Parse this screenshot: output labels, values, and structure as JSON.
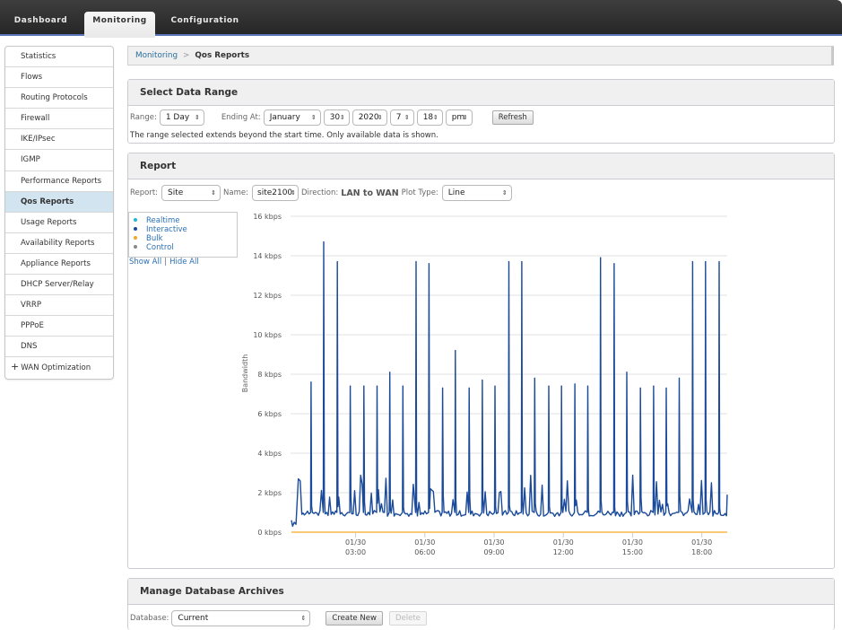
{
  "nav": {
    "tabs": [
      {
        "label": "Dashboard",
        "active": false
      },
      {
        "label": "Monitoring",
        "active": true
      },
      {
        "label": "Configuration",
        "active": false
      }
    ]
  },
  "sidebar": {
    "items": [
      {
        "label": "Statistics"
      },
      {
        "label": "Flows"
      },
      {
        "label": "Routing Protocols"
      },
      {
        "label": "Firewall"
      },
      {
        "label": "IKE/IPsec"
      },
      {
        "label": "IGMP"
      },
      {
        "label": "Performance Reports"
      },
      {
        "label": "Qos Reports",
        "active": true
      },
      {
        "label": "Usage Reports"
      },
      {
        "label": "Availability Reports"
      },
      {
        "label": "Appliance Reports"
      },
      {
        "label": "DHCP Server/Relay"
      },
      {
        "label": "VRRP"
      },
      {
        "label": "PPPoE"
      },
      {
        "label": "DNS"
      },
      {
        "label": "WAN Optimization",
        "expandable": true,
        "expand_symbol": "+"
      }
    ]
  },
  "breadcrumb": {
    "parent": "Monitoring",
    "separator": ">",
    "current": "Qos Reports"
  },
  "data_range": {
    "title": "Select Data Range",
    "range_label": "Range:",
    "range_value": "1 Day",
    "ending_label": "Ending At:",
    "month": "January",
    "day": "30",
    "year": "2020",
    "hour": "7",
    "minute": "18",
    "ampm": "pm",
    "refresh_label": "Refresh",
    "note": "The range selected extends beyond the start time. Only available data is shown."
  },
  "report": {
    "title": "Report",
    "report_label": "Report:",
    "report_value": "Site",
    "name_label": "Name:",
    "name_value": "site2100",
    "direction_label": "Direction:",
    "direction_value": "LAN to WAN",
    "plot_type_label": "Plot Type:",
    "plot_type_value": "Line",
    "legend": [
      {
        "label": "Realtime",
        "color": "#1fb6d9"
      },
      {
        "label": "Interactive",
        "color": "#1a4a99"
      },
      {
        "label": "Bulk",
        "color": "#f5a623"
      },
      {
        "label": "Control",
        "color": "#888888"
      }
    ],
    "show_all": "Show All",
    "hide_all": "Hide All",
    "separator": "|"
  },
  "chart_data": {
    "type": "line",
    "title": "",
    "xlabel": "",
    "ylabel": "Bandwidth",
    "ylim": [
      0,
      16
    ],
    "y_unit": "kbps",
    "y_ticks": [
      {
        "value": 0,
        "label": "0 kbps"
      },
      {
        "value": 2,
        "label": "2 kbps"
      },
      {
        "value": 4,
        "label": "4 kbps"
      },
      {
        "value": 6,
        "label": "6 kbps"
      },
      {
        "value": 8,
        "label": "8 kbps"
      },
      {
        "value": 10,
        "label": "10 kbps"
      },
      {
        "value": 12,
        "label": "12 kbps"
      },
      {
        "value": 14,
        "label": "14 kbps"
      },
      {
        "value": 16,
        "label": "16 kbps"
      }
    ],
    "x_range_hours": [
      0.22,
      19.1
    ],
    "x_ticks": [
      {
        "hour": 3,
        "date": "01/30",
        "time": "03:00"
      },
      {
        "hour": 6,
        "date": "01/30",
        "time": "06:00"
      },
      {
        "hour": 9,
        "date": "01/30",
        "time": "09:00"
      },
      {
        "hour": 12,
        "date": "01/30",
        "time": "12:00"
      },
      {
        "hour": 15,
        "date": "01/30",
        "time": "15:00"
      },
      {
        "hour": 18,
        "date": "01/30",
        "time": "18:00"
      }
    ],
    "grid": true,
    "legend_position": "top-left",
    "baseline_kbps": 0.8,
    "series": [
      {
        "name": "Interactive",
        "color": "#1a4a99",
        "peaks": [
          {
            "hour": 1.07,
            "value": 7.6
          },
          {
            "hour": 1.62,
            "value": 14.7
          },
          {
            "hour": 2.21,
            "value": 13.7
          },
          {
            "hour": 2.77,
            "value": 7.4
          },
          {
            "hour": 3.36,
            "value": 7.4
          },
          {
            "hour": 3.93,
            "value": 7.4
          },
          {
            "hour": 4.48,
            "value": 8.1
          },
          {
            "hour": 5.05,
            "value": 7.4
          },
          {
            "hour": 5.62,
            "value": 13.7
          },
          {
            "hour": 6.18,
            "value": 13.6
          },
          {
            "hour": 6.77,
            "value": 7.3
          },
          {
            "hour": 7.32,
            "value": 9.2
          },
          {
            "hour": 7.92,
            "value": 7.3
          },
          {
            "hour": 8.49,
            "value": 7.7
          },
          {
            "hour": 9.04,
            "value": 7.4
          },
          {
            "hour": 9.64,
            "value": 13.7
          },
          {
            "hour": 10.2,
            "value": 13.7
          },
          {
            "hour": 10.76,
            "value": 7.8
          },
          {
            "hour": 11.37,
            "value": 7.4
          },
          {
            "hour": 11.92,
            "value": 7.4
          },
          {
            "hour": 12.5,
            "value": 7.5
          },
          {
            "hour": 13.06,
            "value": 7.4
          },
          {
            "hour": 13.61,
            "value": 13.9
          },
          {
            "hour": 14.2,
            "value": 13.6
          },
          {
            "hour": 14.75,
            "value": 8.1
          },
          {
            "hour": 15.34,
            "value": 7.3
          },
          {
            "hour": 15.91,
            "value": 7.4
          },
          {
            "hour": 16.46,
            "value": 7.3
          },
          {
            "hour": 17.02,
            "value": 7.8
          },
          {
            "hour": 17.6,
            "value": 13.7
          },
          {
            "hour": 18.16,
            "value": 13.7
          },
          {
            "hour": 18.75,
            "value": 13.7
          }
        ]
      },
      {
        "name": "Bulk",
        "color": "#f5a623",
        "constant_value": 0
      }
    ]
  },
  "archives": {
    "title": "Manage Database Archives",
    "database_label": "Database:",
    "database_value": "Current",
    "create_label": "Create New",
    "delete_label": "Delete"
  }
}
